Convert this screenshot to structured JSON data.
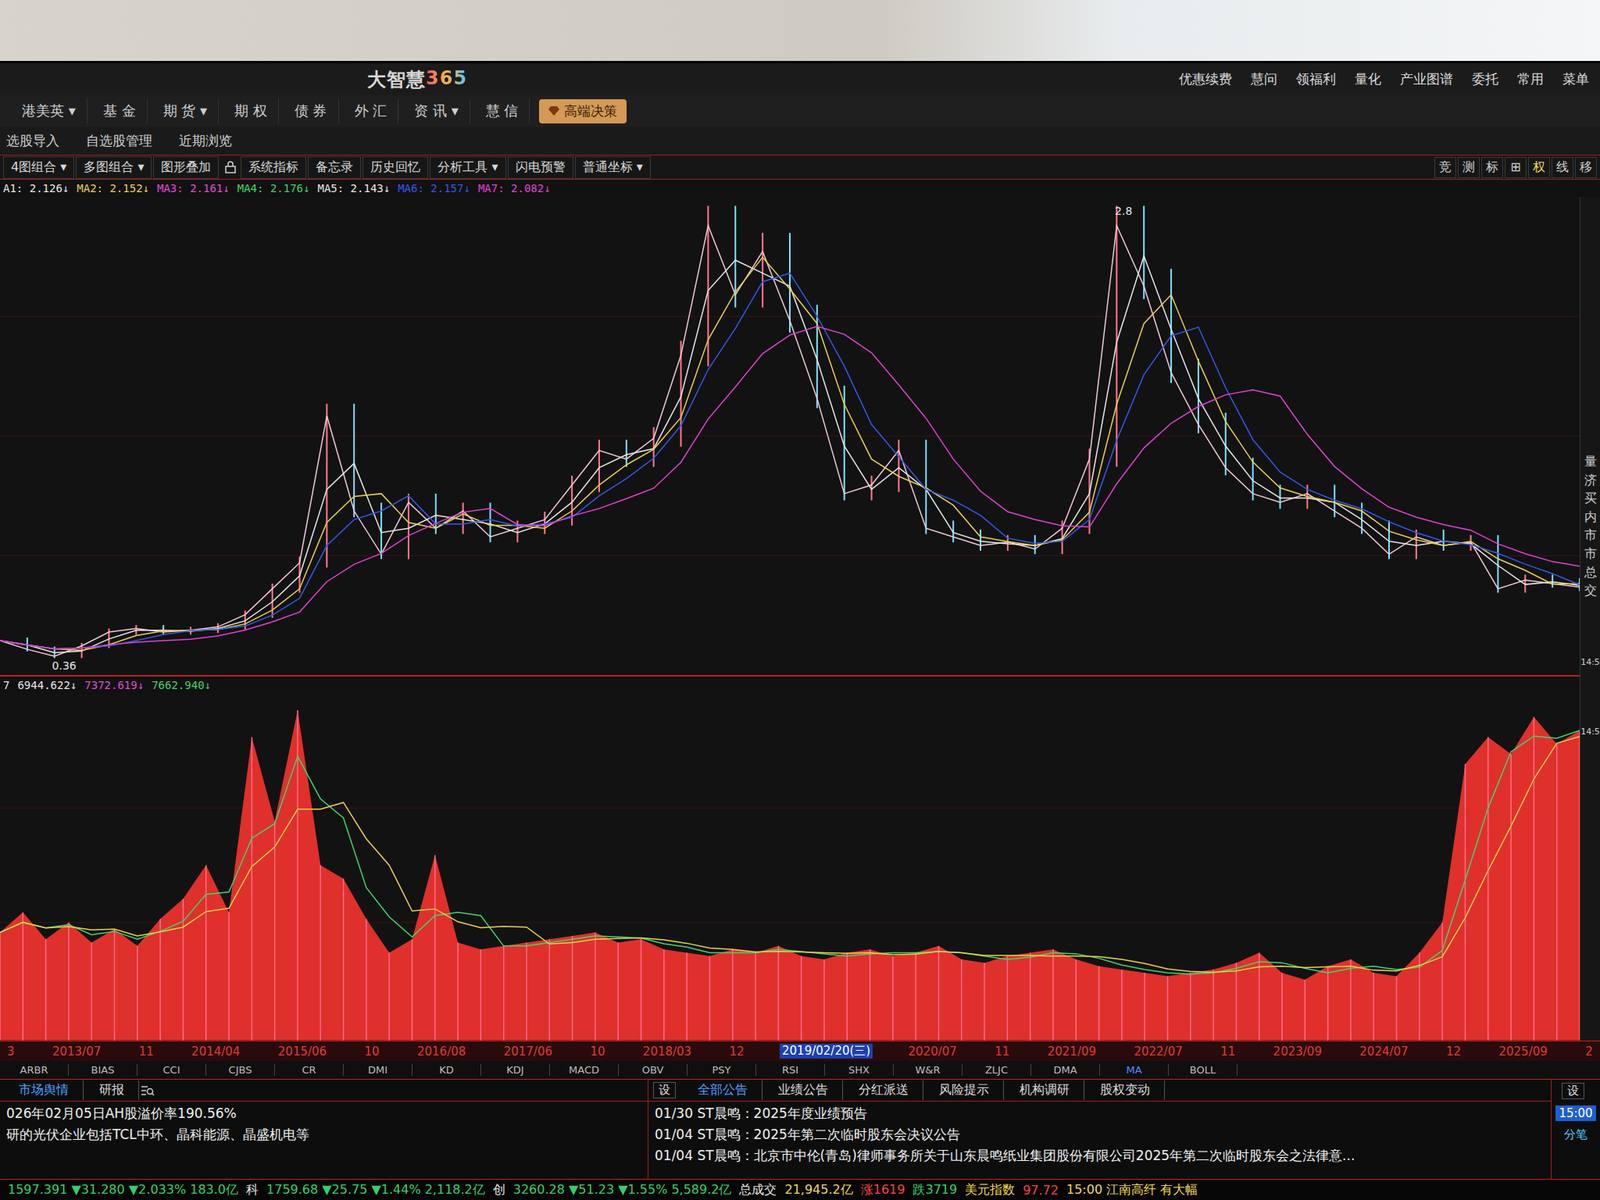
{
  "logo": {
    "text": "大智慧",
    "number": "365"
  },
  "dropdown_glyph": "▾",
  "top_menu": [
    "优惠续费",
    "慧问",
    "领福利",
    "量化",
    "产业图谱",
    "委托",
    "常用",
    "菜单"
  ],
  "nav": [
    {
      "label": "港美英",
      "dropdown": true
    },
    {
      "label": "基 金",
      "dropdown": false
    },
    {
      "label": "期 货",
      "dropdown": true
    },
    {
      "label": "期 权",
      "dropdown": false
    },
    {
      "label": "债 券",
      "dropdown": false
    },
    {
      "label": "外 汇",
      "dropdown": false
    },
    {
      "label": "资 讯",
      "dropdown": true
    },
    {
      "label": "慧 信",
      "dropdown": false
    }
  ],
  "premium": {
    "label": "高端决策"
  },
  "subnav": [
    "选股导入",
    "自选股管理",
    "近期浏览"
  ],
  "toolbar": {
    "items": [
      {
        "label": "4图组合",
        "dropdown": true
      },
      {
        "label": "多图组合",
        "dropdown": true
      },
      {
        "label": "图形叠加",
        "dropdown": false
      },
      {
        "label": "系统指标",
        "dropdown": false
      },
      {
        "label": "备忘录",
        "dropdown": false
      },
      {
        "label": "历史回忆",
        "dropdown": false
      },
      {
        "label": "分析工具",
        "dropdown": true
      },
      {
        "label": "闪电预警",
        "dropdown": false
      },
      {
        "label": "普通坐标",
        "dropdown": true
      }
    ],
    "right": [
      {
        "label": "竞",
        "selected": false
      },
      {
        "label": "测",
        "selected": false
      },
      {
        "label": "标",
        "selected": false
      },
      {
        "label": "⊞",
        "selected": false
      },
      {
        "label": "权",
        "selected": true
      },
      {
        "label": "线",
        "selected": false
      },
      {
        "label": "移",
        "selected": false
      }
    ]
  },
  "ma_legend": [
    {
      "label": "A1: 2.126↓",
      "color": "#e6e6e6"
    },
    {
      "label": "MA2: 2.152↓",
      "color": "#e8d04a"
    },
    {
      "label": "MA3: 2.161↓",
      "color": "#e04ad8"
    },
    {
      "label": "MA4: 2.176↓",
      "color": "#3fd46a"
    },
    {
      "label": "MA5: 2.143↓",
      "color": "#e6e6e6"
    },
    {
      "label": "MA6: 2.157↓",
      "color": "#3358e8"
    },
    {
      "label": "MA7: 2.082↓",
      "color": "#e040d0"
    }
  ],
  "price_chart": {
    "low_label": "0.36",
    "high_label": "2.8",
    "close": [
      0.45,
      0.4,
      0.36,
      0.42,
      0.5,
      0.52,
      0.5,
      0.51,
      0.53,
      0.6,
      0.75,
      0.9,
      1.75,
      1.2,
      0.95,
      1.25,
      1.1,
      1.2,
      1.05,
      1.1,
      1.15,
      1.35,
      1.55,
      1.5,
      1.62,
      2.1,
      2.85,
      2.45,
      2.7,
      2.3,
      1.85,
      1.3,
      1.35,
      1.55,
      1.1,
      1.05,
      1.0,
      1.02,
      0.98,
      1.1,
      1.5,
      2.85,
      2.5,
      2.0,
      1.7,
      1.45,
      1.3,
      1.25,
      1.3,
      1.2,
      1.1,
      0.95,
      1.05,
      1.0,
      1.02,
      0.75,
      0.8,
      0.78,
      0.76
    ]
  },
  "volume_legend": [
    {
      "label": "7",
      "color": "#e6e6e6"
    },
    {
      "label": "6944.622↓",
      "color": "#e6e6e6"
    },
    {
      "label": "7372.619↓",
      "color": "#e04ad8"
    },
    {
      "label": "7662.940↓",
      "color": "#3fd46a"
    }
  ],
  "volume": {
    "values": [
      3200,
      3800,
      3000,
      3500,
      2900,
      3300,
      2800,
      3600,
      4200,
      5200,
      3800,
      9000,
      6500,
      9800,
      5200,
      4800,
      3600,
      2600,
      3000,
      5500,
      2900,
      2700,
      2800,
      2900,
      3000,
      3100,
      3200,
      2900,
      3000,
      2700,
      2600,
      2500,
      2700,
      2600,
      2800,
      2500,
      2400,
      2600,
      2700,
      2500,
      2600,
      2800,
      2400,
      2300,
      2500,
      2600,
      2700,
      2400,
      2200,
      2100,
      2000,
      1900,
      2000,
      2100,
      2300,
      2600,
      2000,
      1800,
      2200,
      2400,
      2000,
      1900,
      2600,
      3500,
      8200,
      9000,
      8500,
      9600,
      8800,
      9200
    ]
  },
  "date_axis": [
    {
      "label": "3",
      "selected": false
    },
    {
      "label": "2013/07",
      "selected": false
    },
    {
      "label": "11",
      "selected": false
    },
    {
      "label": "2014/04",
      "selected": false
    },
    {
      "label": "2015/06",
      "selected": false
    },
    {
      "label": "10",
      "selected": false
    },
    {
      "label": "2016/08",
      "selected": false
    },
    {
      "label": "2017/06",
      "selected": false
    },
    {
      "label": "10",
      "selected": false
    },
    {
      "label": "2018/03",
      "selected": false
    },
    {
      "label": "12",
      "selected": false
    },
    {
      "label": "2019/02/20(三)",
      "selected": true
    },
    {
      "label": "2020/07",
      "selected": false
    },
    {
      "label": "11",
      "selected": false
    },
    {
      "label": "2021/09",
      "selected": false
    },
    {
      "label": "2022/07",
      "selected": false
    },
    {
      "label": "11",
      "selected": false
    },
    {
      "label": "2023/09",
      "selected": false
    },
    {
      "label": "2024/07",
      "selected": false
    },
    {
      "label": "12",
      "selected": false
    },
    {
      "label": "2025/09",
      "selected": false
    },
    {
      "label": "2",
      "selected": false
    }
  ],
  "indicators": [
    {
      "label": "ARBR",
      "selected": false
    },
    {
      "label": "BIAS",
      "selected": false
    },
    {
      "label": "CCI",
      "selected": false
    },
    {
      "label": "CJBS",
      "selected": false
    },
    {
      "label": "CR",
      "selected": false
    },
    {
      "label": "DMI",
      "selected": false
    },
    {
      "label": "KD",
      "selected": false
    },
    {
      "label": "KDJ",
      "selected": false
    },
    {
      "label": "MACD",
      "selected": false
    },
    {
      "label": "OBV",
      "selected": false
    },
    {
      "label": "PSY",
      "selected": false
    },
    {
      "label": "RSI",
      "selected": false
    },
    {
      "label": "SHX",
      "selected": false
    },
    {
      "label": "W&R",
      "selected": false
    },
    {
      "label": "ZLJC",
      "selected": false
    },
    {
      "label": "DMA",
      "selected": false
    },
    {
      "label": "MA",
      "selected": true
    },
    {
      "label": "BOLL",
      "selected": false
    }
  ],
  "right_strip": {
    "chars": [
      "量",
      "济",
      "买",
      "内",
      "市",
      "市",
      "总",
      "交"
    ],
    "times": [
      "14:5",
      "14:5"
    ]
  },
  "news": {
    "tabs": [
      {
        "label": "市场舆情",
        "selected": true
      },
      {
        "label": "研报",
        "selected": false
      }
    ],
    "items": [
      "026年02月05日AH股溢价率190.56%",
      "研的光伏企业包括TCL中环、晶科能源、晶盛机电等"
    ]
  },
  "notices": {
    "settings": "设",
    "tabs": [
      {
        "label": "全部公告",
        "selected": true
      },
      {
        "label": "业绩公告",
        "selected": false
      },
      {
        "label": "分红派送",
        "selected": false
      },
      {
        "label": "风险提示",
        "selected": false
      },
      {
        "label": "机构调研",
        "selected": false
      },
      {
        "label": "股权变动",
        "selected": false
      }
    ],
    "items": [
      {
        "date": "01/30",
        "text": "ST晨鸣：2025年度业绩预告"
      },
      {
        "date": "01/04",
        "text": "ST晨鸣：2025年第二次临时股东会决议公告"
      },
      {
        "date": "01/04",
        "text": "ST晨鸣：北京市中伦(青岛)律师事务所关于山东晨鸣纸业集团股份有限公司2025年第二次临时股东会之法律意..."
      }
    ]
  },
  "side_panel": {
    "settings": "设",
    "time": "15:00",
    "tab": "分笔"
  },
  "status_bar": [
    {
      "text": "1597.391 ▼31.280 ▼2.033% 183.0亿",
      "color": "#35d06a"
    },
    {
      "text": "科",
      "color": "#e6e6e6"
    },
    {
      "text": "1759.68 ▼25.75 ▼1.44% 2,118.2亿",
      "color": "#35d06a"
    },
    {
      "text": "创",
      "color": "#e6e6e6"
    },
    {
      "text": "3260.28 ▼51.23 ▼1.55% 5,589.2亿",
      "color": "#35d06a"
    },
    {
      "text": "总成交",
      "color": "#e6e6e6"
    },
    {
      "text": "21,945.2亿",
      "color": "#f2d94a"
    },
    {
      "text": "涨1619",
      "color": "#ff4040"
    },
    {
      "text": "跌3719",
      "color": "#35d06a"
    },
    {
      "text": "美元指数",
      "color": "#f2d94a"
    },
    {
      "text": "97.72",
      "color": "#ff4040"
    },
    {
      "text": "15:00 江南高纤 有大幅",
      "color": "#f2d94a"
    }
  ]
}
